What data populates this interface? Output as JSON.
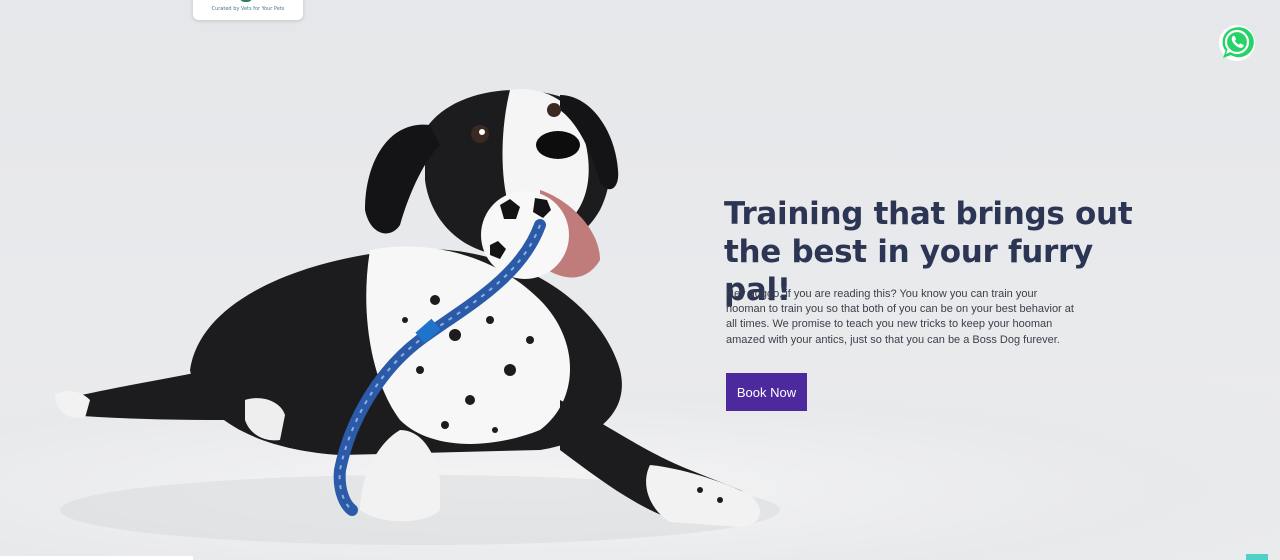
{
  "logo": {
    "tagline": "Curated by Vets for Your Pets"
  },
  "hero": {
    "headline": "Training that brings out the best in your furry pal!",
    "description": "Hey doggo, if you are reading this? You know you can train your hooman to train you so that both of you can be on your best behavior at all times. We promise to teach you new tricks to keep your hooman amazed with your antics, just so that you can be a Boss Dog furever.",
    "cta_label": "Book Now"
  },
  "icons": {
    "whatsapp": "whatsapp-icon",
    "scroll_top": "scroll-to-top-icon"
  },
  "colors": {
    "background": "#e7e8ea",
    "headline": "#2c3553",
    "button": "#4c2a9e",
    "whatsapp": "#25d366",
    "accent": "#4fd1c5"
  }
}
